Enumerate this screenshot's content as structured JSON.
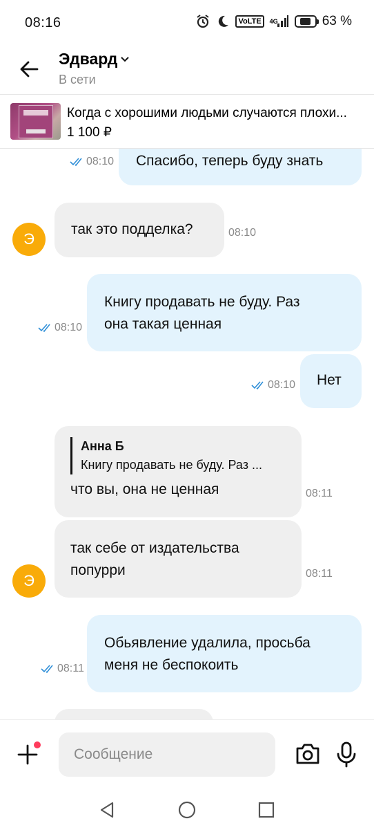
{
  "status_bar": {
    "time": "08:16",
    "icons": [
      "alarm-icon",
      "moon-icon",
      "volte-icon",
      "signal-4g-icon",
      "battery-icon"
    ],
    "volte_label": "VoLTE",
    "network_label": "4G",
    "battery_level": 0.63,
    "battery_percent": "63 %"
  },
  "header": {
    "contact_name": "Эдвард",
    "contact_status": "В сети"
  },
  "ad": {
    "title": "Когда с хорошими людьми случаются плохи...",
    "price": "1 100 ₽"
  },
  "messages": [
    {
      "direction": "out",
      "text": "Спасибо, теперь буду знать",
      "time": "08:10",
      "read": true
    },
    {
      "direction": "in",
      "text": "так это подделка?",
      "time": "08:10",
      "avatar": "Э"
    },
    {
      "direction": "out",
      "text_lines": [
        "Книгу продавать не буду. Раз",
        "она такая ценная"
      ],
      "time": "08:10",
      "read": true
    },
    {
      "direction": "out",
      "text": "Нет",
      "time": "08:10",
      "read": true
    },
    {
      "direction": "in",
      "reply_author": "Анна Б",
      "reply_text": "Книгу продавать не буду. Раз ...",
      "text": "что вы, она не ценная",
      "time": "08:11"
    },
    {
      "direction": "in",
      "text_lines": [
        "так себе от издательства",
        "попурри"
      ],
      "time": "08:11",
      "avatar": "Э"
    },
    {
      "direction": "out",
      "text_lines": [
        "Обьявление удалила, просьба",
        "меня не беспокоить"
      ],
      "time": "08:11",
      "read": true
    }
  ],
  "composer": {
    "placeholder": "Сообщение"
  },
  "colors": {
    "outgoing_bubble": "#e3f3fd",
    "incoming_bubble": "#efefef",
    "avatar": "#f9ab09",
    "read_check": "#2f8fd8",
    "notification_dot": "#ff3b5c"
  }
}
